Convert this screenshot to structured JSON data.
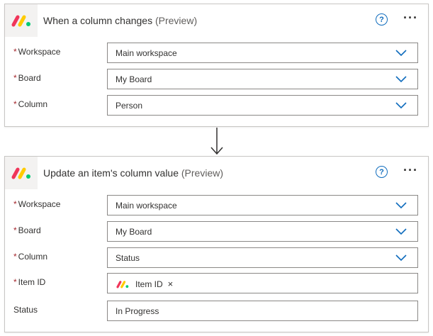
{
  "trigger": {
    "title": "When a column changes",
    "title_suffix": "(Preview)",
    "help_glyph": "?",
    "more_glyph": "···",
    "fields": [
      {
        "required_mark": "*",
        "label": "Workspace",
        "value": "Main workspace"
      },
      {
        "required_mark": "*",
        "label": "Board",
        "value": "My Board"
      },
      {
        "required_mark": "*",
        "label": "Column",
        "value": "Person"
      }
    ]
  },
  "action": {
    "title": "Update an item's column value",
    "title_suffix": "(Preview)",
    "help_glyph": "?",
    "more_glyph": "···",
    "fields": [
      {
        "required_mark": "*",
        "label": "Workspace",
        "value": "Main workspace"
      },
      {
        "required_mark": "*",
        "label": "Board",
        "value": "My Board"
      },
      {
        "required_mark": "*",
        "label": "Column",
        "value": "Status"
      },
      {
        "required_mark": "*",
        "label": "Item ID",
        "token_label": "Item ID",
        "token_close": "×"
      },
      {
        "label": "Status",
        "value": "In Progress"
      }
    ]
  },
  "icons": {
    "logo": "monday-logo-icon",
    "help": "help-circle-icon",
    "more": "more-horizontal-icon",
    "dropdown": "chevron-down-icon",
    "connector": "arrow-down-icon"
  },
  "colors": {
    "accent": "#0f6cbd",
    "required": "#a4262c",
    "logo_red": "#f0365a",
    "logo_yellow": "#ffcb00",
    "logo_green": "#00ca72"
  }
}
